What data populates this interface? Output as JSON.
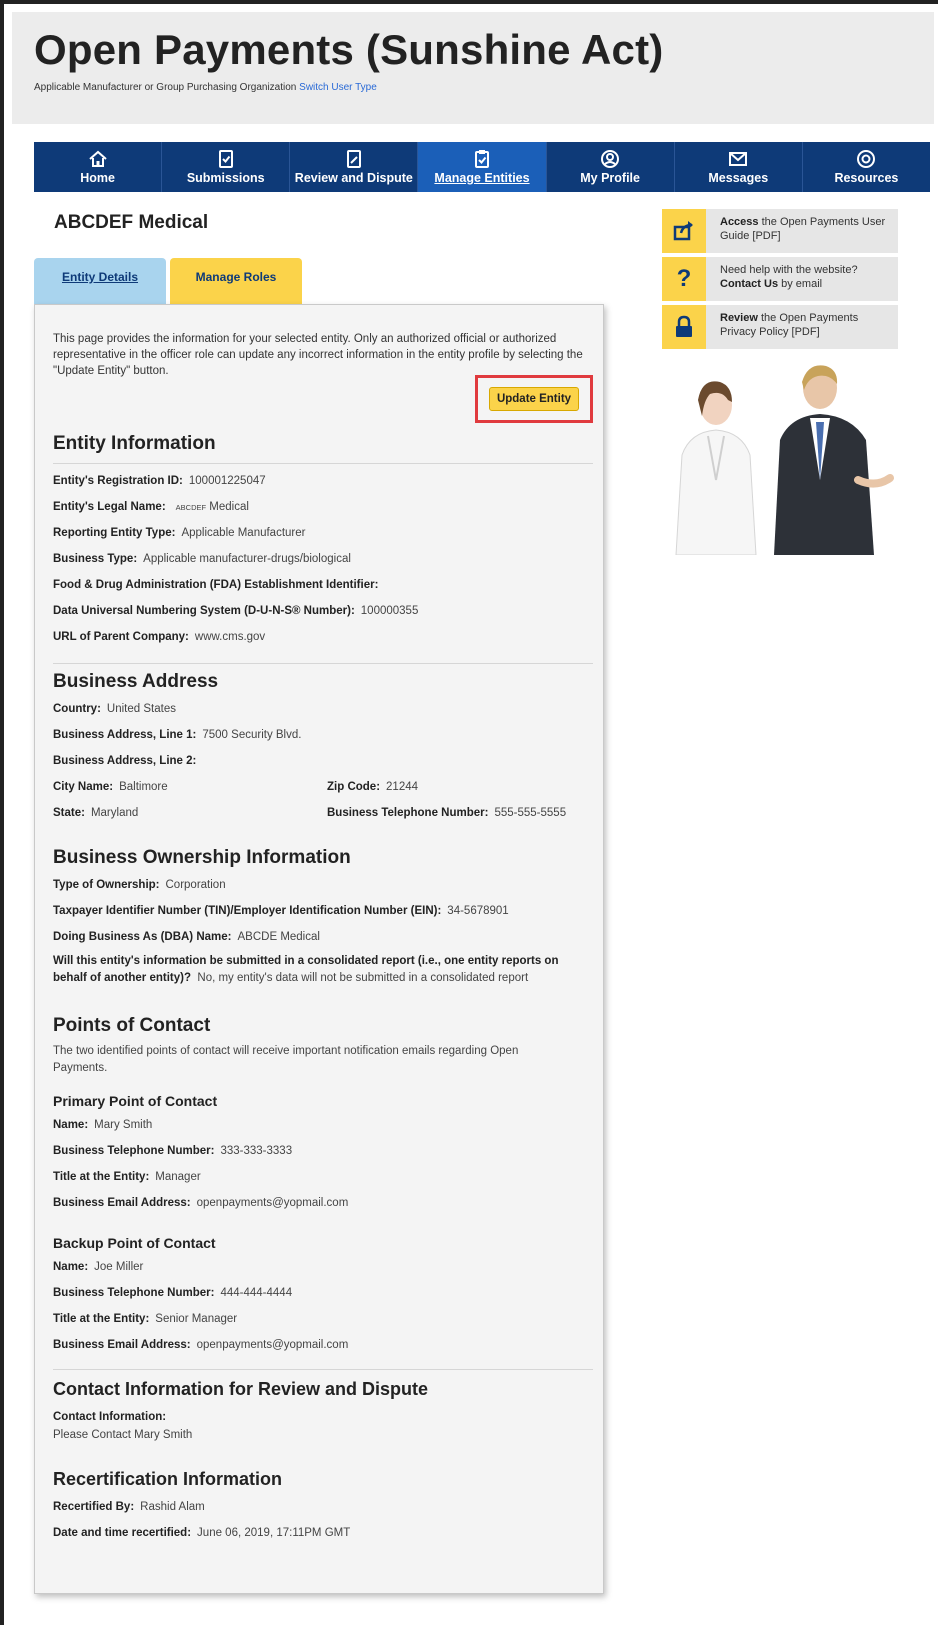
{
  "header": {
    "title": "Open Payments (Sunshine Act)",
    "subtitle": "Applicable Manufacturer or Group Purchasing Organization",
    "switch_link": "Switch User Type"
  },
  "nav": {
    "items": [
      {
        "label": "Home",
        "icon": "home-icon"
      },
      {
        "label": "Submissions",
        "icon": "submissions-icon"
      },
      {
        "label": "Review and Dispute",
        "icon": "review-icon"
      },
      {
        "label": "Manage Entities",
        "icon": "clipboard-icon",
        "active": true
      },
      {
        "label": "My Profile",
        "icon": "profile-icon"
      },
      {
        "label": "Messages",
        "icon": "mail-icon"
      },
      {
        "label": "Resources",
        "icon": "gear-icon"
      }
    ]
  },
  "entity_name": "ABCDEF Medical",
  "tabs": {
    "details": "Entity Details",
    "roles": "Manage Roles"
  },
  "intro": "This page provides the information for your selected entity. Only an authorized official or authorized representative in the officer role can update any incorrect information in the entity profile by selecting the \"Update Entity\" button.",
  "update_button": "Update Entity",
  "entity_info": {
    "title": "Entity Information",
    "reg_id_label": "Entity's Registration ID:",
    "reg_id": "100001225047",
    "legal_name_label": "Entity's Legal Name:",
    "legal_name_prefix": "ABCDEF",
    "legal_name": "Medical",
    "reporting_type_label": "Reporting Entity Type:",
    "reporting_type": "Applicable Manufacturer",
    "business_type_label": "Business Type:",
    "business_type": "Applicable manufacturer-drugs/biological",
    "fda_label": "Food & Drug Administration (FDA) Establishment Identifier:",
    "duns_label": "Data Universal Numbering System (D-U-N-S® Number):",
    "duns": "100000355",
    "url_label": "URL of Parent Company:",
    "url": "www.cms.gov"
  },
  "business_address": {
    "title": "Business Address",
    "country_label": "Country:",
    "country": "United States",
    "line1_label": "Business Address, Line 1:",
    "line1": "7500 Security Blvd.",
    "line2_label": "Business Address, Line 2:",
    "city_label": "City Name:",
    "city": "Baltimore",
    "zip_label": "Zip Code:",
    "zip": "21244",
    "state_label": "State:",
    "state": "Maryland",
    "phone_label": "Business Telephone Number:",
    "phone": "555-555-5555"
  },
  "ownership": {
    "title": "Business Ownership Information",
    "type_label": "Type of Ownership:",
    "type": "Corporation",
    "tin_label": "Taxpayer Identifier Number (TIN)/Employer Identification Number (EIN):",
    "tin": "34-5678901",
    "dba_label": "Doing Business As (DBA) Name:",
    "dba": "ABCDE Medical",
    "consolidated_label": "Will this entity's information be submitted in a consolidated report (i.e., one entity reports on behalf of another entity)?",
    "consolidated": "No, my entity's data will not be submitted in a consolidated report"
  },
  "contacts": {
    "title": "Points of Contact",
    "description": "The two identified points of contact will receive important notification emails regarding Open Payments.",
    "primary": {
      "title": "Primary Point of Contact",
      "name_label": "Name:",
      "name": "Mary Smith",
      "phone_label": "Business Telephone Number:",
      "phone": "333-333-3333",
      "title_label": "Title at the Entity:",
      "job_title": "Manager",
      "email_label": "Business Email Address:",
      "email": "openpayments@yopmail.com"
    },
    "backup": {
      "title": "Backup Point of Contact",
      "name_label": "Name:",
      "name": "Joe Miller",
      "phone_label": "Business Telephone Number:",
      "phone": "444-444-4444",
      "title_label": "Title at the Entity:",
      "job_title": "Senior Manager",
      "email_label": "Business Email Address:",
      "email": "openpayments@yopmail.com"
    }
  },
  "review_contact": {
    "title": "Contact Information for Review and Dispute",
    "label": "Contact Information:",
    "value": "Please Contact Mary Smith"
  },
  "recert": {
    "title": "Recertification Information",
    "by_label": "Recertified By:",
    "by": "Rashid Alam",
    "date_label": "Date and time recertified:",
    "date": "June 06, 2019, 17:11PM GMT"
  },
  "sidebar": {
    "guide": {
      "bold": "Access",
      "text": " the Open Payments User Guide [PDF]",
      "icon": "share-icon"
    },
    "help": {
      "line1": "Need help with the website?",
      "bold": "Contact Us",
      "text": " by email",
      "icon": "question-icon"
    },
    "privacy": {
      "bold": "Review",
      "text": " the Open Payments Privacy Policy [PDF]",
      "icon": "lock-icon"
    }
  },
  "colors": {
    "nav": "#0e3a78",
    "nav_active": "#1b5fb8",
    "accent_yellow": "#fbd34a",
    "tab_blue": "#a9d4ee",
    "highlight_red": "#e03a3e"
  }
}
